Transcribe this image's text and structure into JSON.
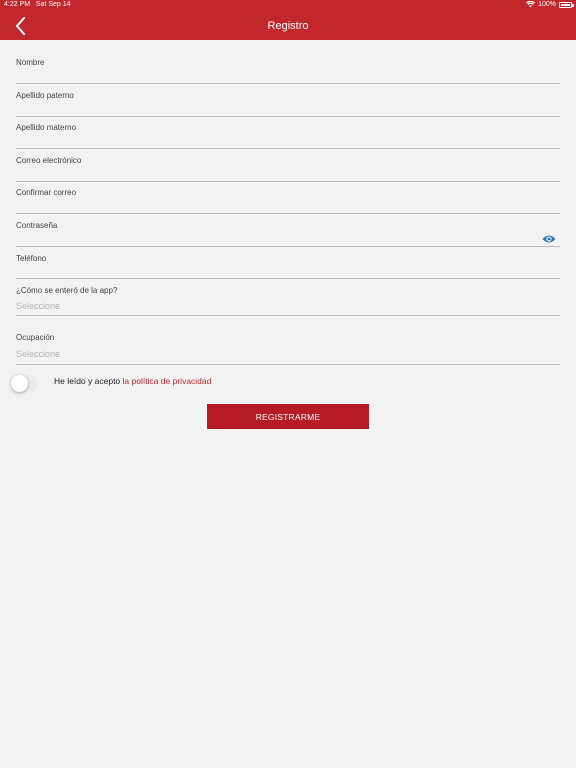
{
  "status_bar": {
    "time": "4:22 PM",
    "date": "Sat Sep 14",
    "battery": "100%"
  },
  "nav": {
    "title": "Registro",
    "back_icon": "chevron-left-icon"
  },
  "form": {
    "nombre": {
      "label": "Nombre"
    },
    "apellido_paterno": {
      "label": "Apellido paterno"
    },
    "apellido_materno": {
      "label": "Apellido materno"
    },
    "correo": {
      "label": "Correo electrónico"
    },
    "confirmar_correo": {
      "label": "Confirmar correo"
    },
    "contrasena": {
      "label": "Contraseña",
      "icon": "eye-icon"
    },
    "telefono": {
      "label": "Teléfono"
    },
    "como_se_entero": {
      "label": "¿Cómo se enteró de la app?",
      "placeholder": "Seleccione"
    },
    "ocupacion": {
      "label": "Ocupación",
      "placeholder": "Seleccione"
    }
  },
  "terms": {
    "prefix": "He leído y acepto",
    "link": "la política de privacidad",
    "accepted": false
  },
  "submit": {
    "label": "REGISTRARME"
  },
  "colors": {
    "brand": "#c1272d",
    "button": "#b71c24",
    "eye": "#2e7ab8",
    "background": "#f2f2f2"
  }
}
